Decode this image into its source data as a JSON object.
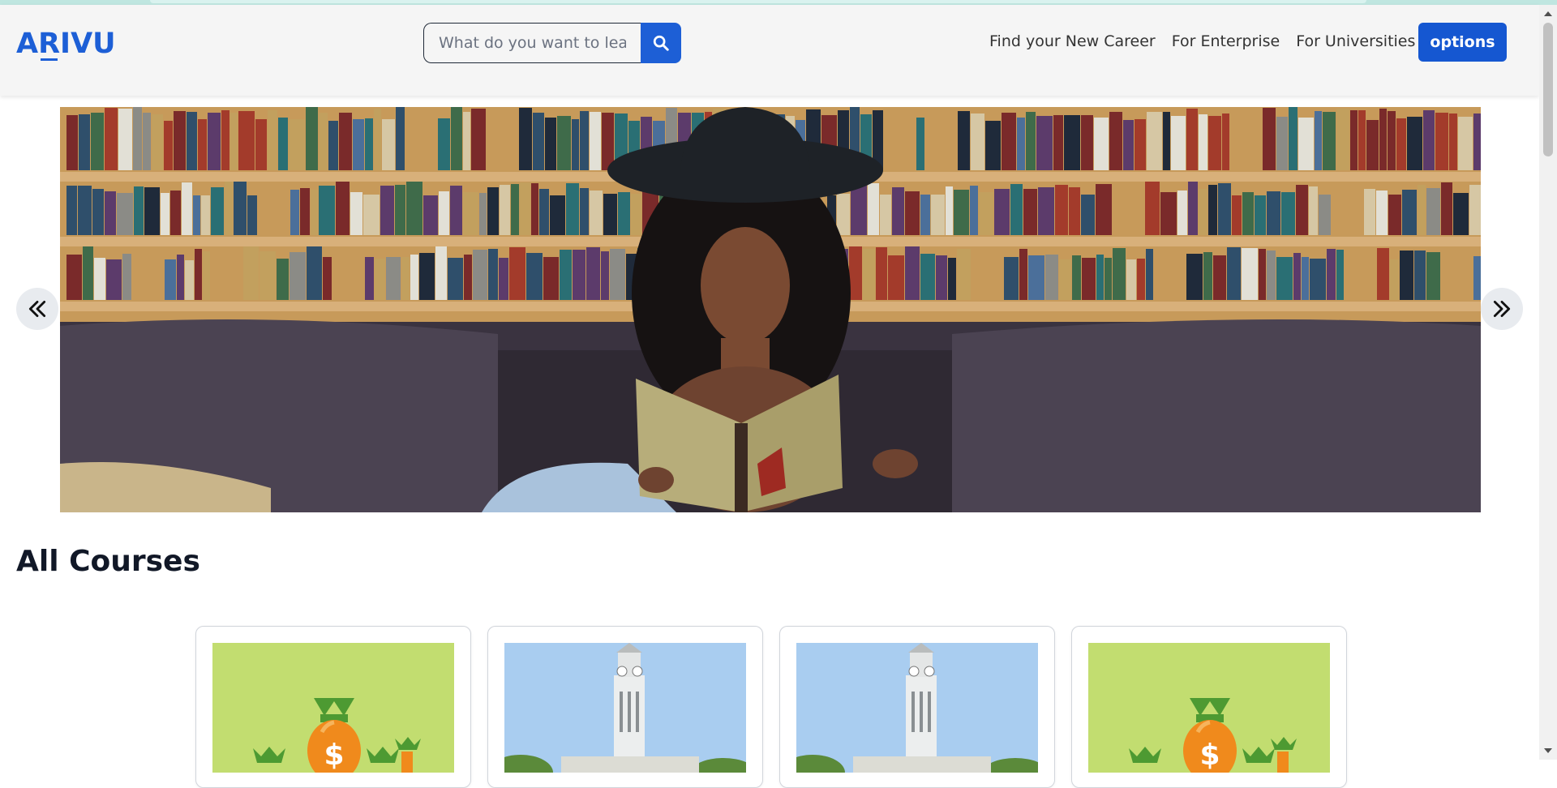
{
  "brand": {
    "logo_text": "ARIVU",
    "logo_prefix": "A",
    "logo_macron_letter": "R",
    "logo_suffix": "IVU",
    "accent": "#1d5fd6"
  },
  "search": {
    "placeholder": "What do you want to learn?",
    "button_icon": "search-icon"
  },
  "nav": {
    "links": [
      {
        "label": "Find your New Career"
      },
      {
        "label": "For Enterprise"
      },
      {
        "label": "For Universities"
      }
    ],
    "options_label": "options"
  },
  "carousel": {
    "slide_alt": "Woman with curly hair and a black hat reading a book on a leather sofa in front of bookshelves",
    "prev_icon": "double-chevron-left-icon",
    "next_icon": "double-chevron-right-icon"
  },
  "courses": {
    "title": "All Courses",
    "cards": [
      {
        "image": "money-bag-icon"
      },
      {
        "image": "clock-tower-image"
      },
      {
        "image": "clock-tower-image"
      },
      {
        "image": "money-bag-icon"
      }
    ]
  }
}
